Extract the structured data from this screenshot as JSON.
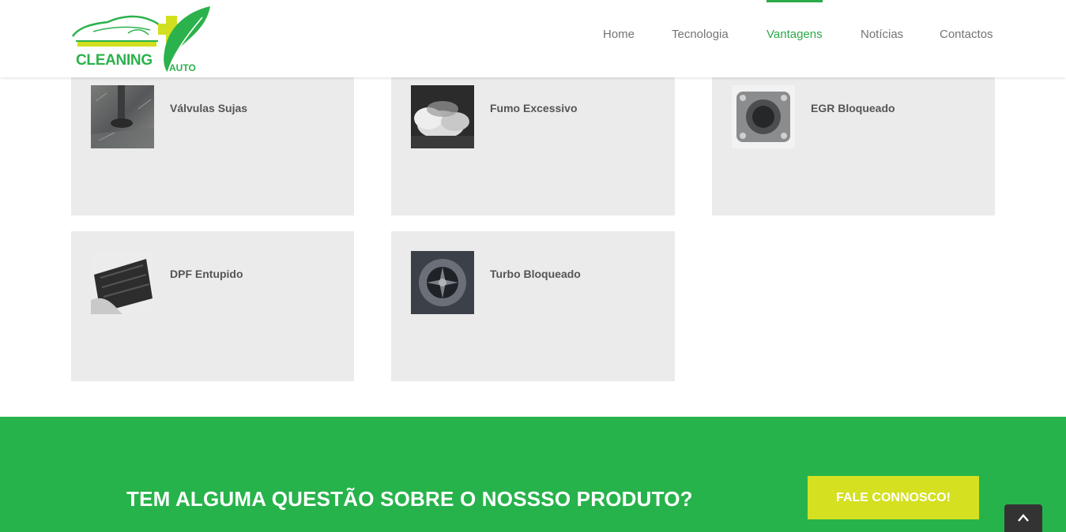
{
  "logo": {
    "word_main": "CLEANING",
    "word_sub": "AUTO"
  },
  "nav": {
    "items": [
      {
        "label": "Home",
        "active": false
      },
      {
        "label": "Tecnologia",
        "active": false
      },
      {
        "label": "Vantagens",
        "active": true
      },
      {
        "label": "Notícias",
        "active": false
      },
      {
        "label": "Contactos",
        "active": false
      }
    ]
  },
  "cards": [
    {
      "title": "Válvulas Sujas",
      "icon": "dirty-valve-photo"
    },
    {
      "title": "Fumo Excessivo",
      "icon": "excessive-smoke-photo"
    },
    {
      "title": "EGR Bloqueado",
      "icon": "egr-valve-photo"
    },
    {
      "title": "DPF Entupido",
      "icon": "clogged-dpf-photo"
    },
    {
      "title": "Turbo Bloqueado",
      "icon": "turbo-photo"
    }
  ],
  "cta": {
    "text": "TEM ALGUMA QUESTÃO SOBRE O NOSSSO PRODUTO?",
    "button_label": "FALE CONNOSCO!"
  },
  "colors": {
    "brand_green": "#27b34b",
    "nav_active": "#2aaa48",
    "cta_button": "#d4e020",
    "card_bg": "#ebebeb"
  }
}
